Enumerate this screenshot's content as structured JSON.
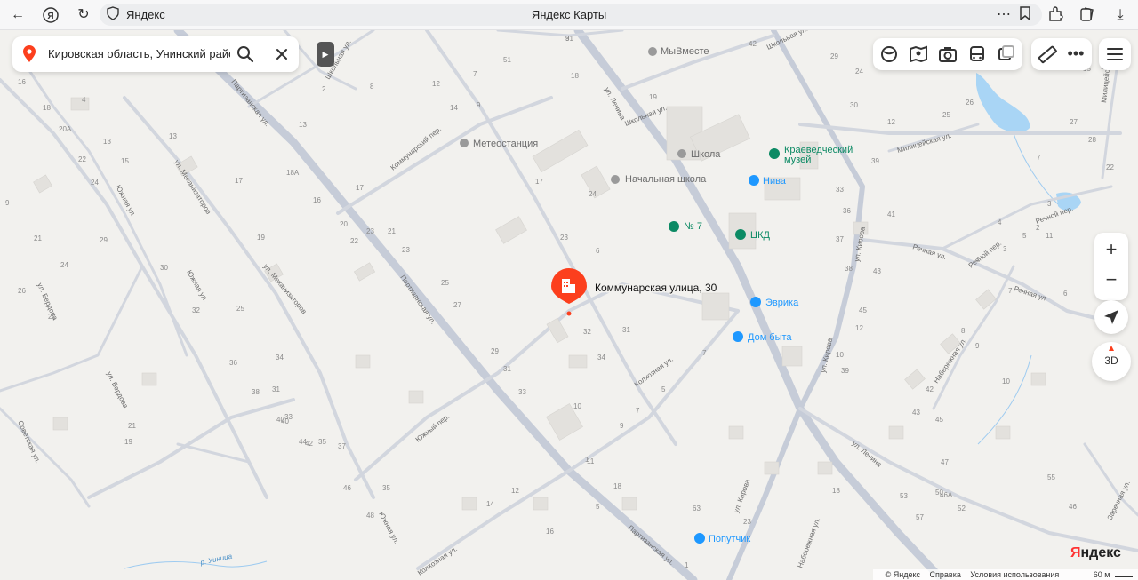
{
  "browser": {
    "tab_host": "Яндекс",
    "page_title": "Яндекс Карты",
    "icons": [
      "back-icon",
      "yandex-browser-icon",
      "reload-icon",
      "shield-icon",
      "more-icon",
      "bookmark-icon",
      "extensions-icon",
      "collections-icon",
      "download-icon"
    ]
  },
  "search": {
    "value": "Кировская область, Унинский район,"
  },
  "pin": {
    "label": "Коммунарская улица, 30"
  },
  "streets": [
    {
      "name": "ул. Ленина"
    },
    {
      "name": "Партизанская ул."
    },
    {
      "name": "Коммунарский пер."
    },
    {
      "name": "ул. Механизаторов"
    },
    {
      "name": "Южная ул."
    },
    {
      "name": "ул. Бердова"
    },
    {
      "name": "Советская ул."
    },
    {
      "name": "Южный пер."
    },
    {
      "name": "Колхозная ул."
    },
    {
      "name": "ул. Кирова"
    },
    {
      "name": "Речная ул."
    },
    {
      "name": "Речной пер."
    },
    {
      "name": "Набережная ул."
    },
    {
      "name": "Милицейская ул."
    },
    {
      "name": "Школьная ул."
    },
    {
      "name": "Заречная ул."
    },
    {
      "name": "р. Уиница"
    }
  ],
  "pois": [
    {
      "name": "МыВместе"
    },
    {
      "name": "Метеостанция"
    },
    {
      "name": "Школа"
    },
    {
      "name": "Начальная школа"
    },
    {
      "name": "Краеведческий"
    },
    {
      "name": "музей"
    },
    {
      "name": "Нива"
    },
    {
      "name": "№ 7"
    },
    {
      "name": "ЦКД"
    },
    {
      "name": "Эврика"
    },
    {
      "name": "Дом быта"
    },
    {
      "name": "Попутчик"
    }
  ],
  "house_numbers": [
    "31",
    "42",
    "4",
    "7",
    "51",
    "18",
    "12",
    "8",
    "14",
    "9",
    "16",
    "18",
    "20А",
    "13",
    "13",
    "15",
    "22",
    "24",
    "17",
    "17",
    "18А",
    "16",
    "20",
    "22",
    "21",
    "24",
    "9",
    "26",
    "27",
    "29",
    "30",
    "32",
    "31",
    "33",
    "35",
    "34",
    "37",
    "40",
    "44",
    "42",
    "46",
    "48",
    "19",
    "23",
    "25",
    "23",
    "21",
    "25",
    "27",
    "29",
    "31",
    "33",
    "35",
    "19",
    "21",
    "36",
    "38",
    "40",
    "10",
    "32",
    "34",
    "31",
    "6",
    "23",
    "17",
    "24",
    "19",
    "2",
    "13",
    "5",
    "7",
    "7",
    "9",
    "11",
    "12",
    "14",
    "16",
    "18",
    "23",
    "24",
    "25",
    "26",
    "27",
    "28",
    "29",
    "30",
    "33",
    "36",
    "37",
    "38",
    "39",
    "41",
    "43",
    "45",
    "10",
    "12",
    "39",
    "42",
    "43",
    "45",
    "47",
    "50",
    "52",
    "53",
    "57",
    "55",
    "46",
    "46А",
    "63",
    "1",
    "1",
    "5",
    "7",
    "12",
    "13",
    "15",
    "16",
    "3",
    "4",
    "2",
    "3",
    "4",
    "5",
    "6",
    "7",
    "8",
    "9",
    "10",
    "11",
    "18",
    "22",
    "9"
  ],
  "controls": {
    "zoom_in": "+",
    "zoom_out": "−",
    "btn_3d": "3D",
    "icons": [
      "layers-icon",
      "panorama-icon",
      "camera-icon",
      "transit-icon",
      "traffic-icon",
      "ruler-icon",
      "more-icon",
      "menu-icon",
      "geolocation-icon",
      "compass-icon"
    ]
  },
  "footer": {
    "copyright": "© Яндекс",
    "help": "Справка",
    "terms": "Условия использования",
    "scale": "60 м"
  },
  "logo": {
    "first": "Я",
    "rest": "ндекс"
  },
  "colors": {
    "map_background": "#f2f1ee",
    "road": "#c6ccd8",
    "building": "#e3e1dd",
    "pin": "#fc3f1d",
    "poi_blue": "#1e98ff",
    "poi_green": "#0c8a64",
    "water": "#a9d5f5"
  }
}
